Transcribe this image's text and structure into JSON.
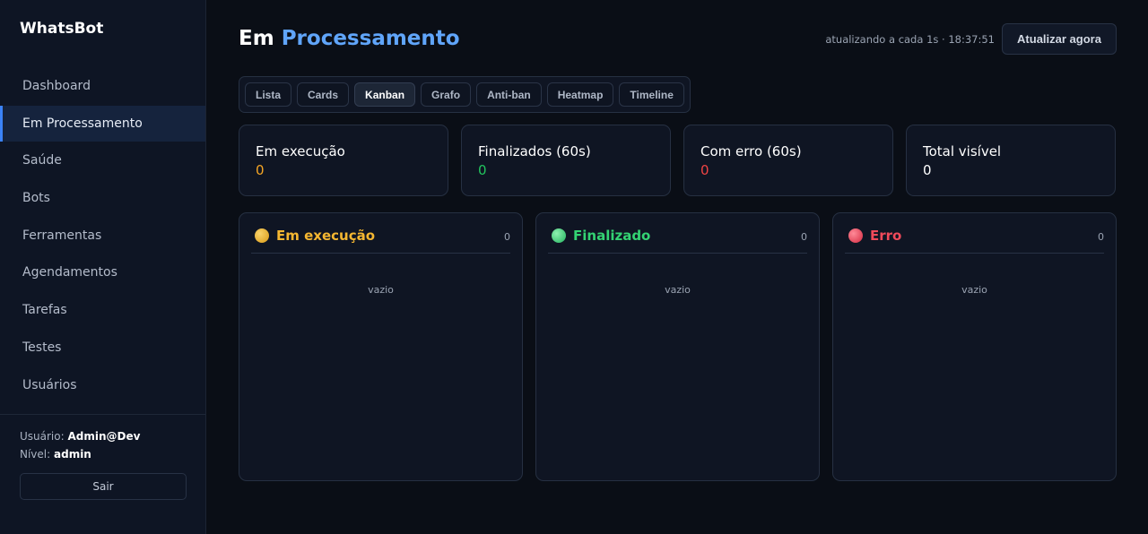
{
  "app": {
    "brand": "WhatsBot"
  },
  "sidebar": {
    "items": [
      {
        "label": "Dashboard",
        "active": false
      },
      {
        "label": "Em Processamento",
        "active": true
      },
      {
        "label": "Saúde",
        "active": false
      },
      {
        "label": "Bots",
        "active": false
      },
      {
        "label": "Ferramentas",
        "active": false
      },
      {
        "label": "Agendamentos",
        "active": false
      },
      {
        "label": "Tarefas",
        "active": false
      },
      {
        "label": "Testes",
        "active": false
      },
      {
        "label": "Usuários",
        "active": false
      }
    ],
    "user_label": "Usuário:",
    "user_value": "Admin@Dev",
    "level_label": "Nível:",
    "level_value": "admin",
    "logout_label": "Sair"
  },
  "header": {
    "title_prefix": "Em",
    "title_accent": "Processamento",
    "refresh_status": "atualizando a cada 1s · 18:37:51",
    "refresh_button": "Atualizar agora"
  },
  "tabs": [
    {
      "label": "Lista",
      "active": false
    },
    {
      "label": "Cards",
      "active": false
    },
    {
      "label": "Kanban",
      "active": true
    },
    {
      "label": "Grafo",
      "active": false
    },
    {
      "label": "Anti-ban",
      "active": false
    },
    {
      "label": "Heatmap",
      "active": false
    },
    {
      "label": "Timeline",
      "active": false
    }
  ],
  "stats": [
    {
      "label": "Em execução",
      "value": "0",
      "color": "#f5a524"
    },
    {
      "label": "Finalizados (60s)",
      "value": "0",
      "color": "#22c55e"
    },
    {
      "label": "Com erro (60s)",
      "value": "0",
      "color": "#ef4444"
    },
    {
      "label": "Total visível",
      "value": "0",
      "color": "#ffffff"
    }
  ],
  "kanban": [
    {
      "title": "Em execução",
      "count": "0",
      "empty": "vazio",
      "color": "#f5b731",
      "dot_color": "#e9b330"
    },
    {
      "title": "Finalizado",
      "count": "0",
      "empty": "vazio",
      "color": "#34d373",
      "dot_color": "#3fd17a"
    },
    {
      "title": "Erro",
      "count": "0",
      "empty": "vazio",
      "color": "#f04a5a",
      "dot_color": "#ee4458"
    }
  ]
}
